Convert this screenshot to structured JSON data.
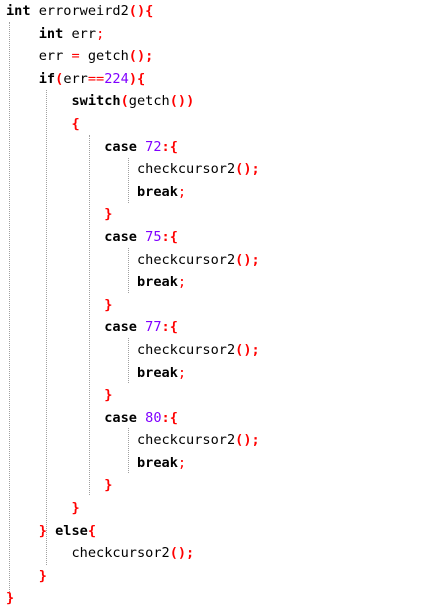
{
  "code": {
    "lines": [
      [
        {
          "t": "int",
          "c": "kw"
        },
        {
          "t": " errorweird2",
          "c": "plain"
        },
        {
          "t": "(){",
          "c": "br"
        }
      ],
      [
        {
          "t": "    ",
          "c": "plain"
        },
        {
          "t": "int",
          "c": "kw"
        },
        {
          "t": " err",
          "c": "plain"
        },
        {
          "t": ";",
          "c": "op"
        }
      ],
      [
        {
          "t": "    err ",
          "c": "plain"
        },
        {
          "t": "=",
          "c": "op"
        },
        {
          "t": " getch",
          "c": "plain"
        },
        {
          "t": "();",
          "c": "br"
        }
      ],
      [
        {
          "t": "    ",
          "c": "plain"
        },
        {
          "t": "if",
          "c": "kw"
        },
        {
          "t": "(",
          "c": "br"
        },
        {
          "t": "err",
          "c": "plain"
        },
        {
          "t": "==",
          "c": "op"
        },
        {
          "t": "224",
          "c": "num"
        },
        {
          "t": "){",
          "c": "br"
        }
      ],
      [
        {
          "t": "        ",
          "c": "plain"
        },
        {
          "t": "switch",
          "c": "kw"
        },
        {
          "t": "(",
          "c": "br"
        },
        {
          "t": "getch",
          "c": "plain"
        },
        {
          "t": "())",
          "c": "br"
        }
      ],
      [
        {
          "t": "        ",
          "c": "plain"
        },
        {
          "t": "{",
          "c": "br"
        }
      ],
      [
        {
          "t": "            ",
          "c": "plain"
        },
        {
          "t": "case",
          "c": "kw"
        },
        {
          "t": " ",
          "c": "plain"
        },
        {
          "t": "72",
          "c": "num"
        },
        {
          "t": ":{",
          "c": "br"
        }
      ],
      [
        {
          "t": "                checkcursor2",
          "c": "plain"
        },
        {
          "t": "();",
          "c": "br"
        }
      ],
      [
        {
          "t": "                ",
          "c": "plain"
        },
        {
          "t": "break",
          "c": "kw"
        },
        {
          "t": ";",
          "c": "op"
        }
      ],
      [
        {
          "t": "            ",
          "c": "plain"
        },
        {
          "t": "}",
          "c": "br"
        }
      ],
      [
        {
          "t": "            ",
          "c": "plain"
        },
        {
          "t": "case",
          "c": "kw"
        },
        {
          "t": " ",
          "c": "plain"
        },
        {
          "t": "75",
          "c": "num"
        },
        {
          "t": ":{",
          "c": "br"
        }
      ],
      [
        {
          "t": "                checkcursor2",
          "c": "plain"
        },
        {
          "t": "();",
          "c": "br"
        }
      ],
      [
        {
          "t": "                ",
          "c": "plain"
        },
        {
          "t": "break",
          "c": "kw"
        },
        {
          "t": ";",
          "c": "op"
        }
      ],
      [
        {
          "t": "            ",
          "c": "plain"
        },
        {
          "t": "}",
          "c": "br"
        }
      ],
      [
        {
          "t": "            ",
          "c": "plain"
        },
        {
          "t": "case",
          "c": "kw"
        },
        {
          "t": " ",
          "c": "plain"
        },
        {
          "t": "77",
          "c": "num"
        },
        {
          "t": ":{",
          "c": "br"
        }
      ],
      [
        {
          "t": "                checkcursor2",
          "c": "plain"
        },
        {
          "t": "();",
          "c": "br"
        }
      ],
      [
        {
          "t": "                ",
          "c": "plain"
        },
        {
          "t": "break",
          "c": "kw"
        },
        {
          "t": ";",
          "c": "op"
        }
      ],
      [
        {
          "t": "            ",
          "c": "plain"
        },
        {
          "t": "}",
          "c": "br"
        }
      ],
      [
        {
          "t": "            ",
          "c": "plain"
        },
        {
          "t": "case",
          "c": "kw"
        },
        {
          "t": " ",
          "c": "plain"
        },
        {
          "t": "80",
          "c": "num"
        },
        {
          "t": ":{",
          "c": "br"
        }
      ],
      [
        {
          "t": "                checkcursor2",
          "c": "plain"
        },
        {
          "t": "();",
          "c": "br"
        }
      ],
      [
        {
          "t": "                ",
          "c": "plain"
        },
        {
          "t": "break",
          "c": "kw"
        },
        {
          "t": ";",
          "c": "op"
        }
      ],
      [
        {
          "t": "            ",
          "c": "plain"
        },
        {
          "t": "}",
          "c": "br"
        }
      ],
      [
        {
          "t": "        ",
          "c": "plain"
        },
        {
          "t": "}",
          "c": "br"
        }
      ],
      [
        {
          "t": "    ",
          "c": "plain"
        },
        {
          "t": "}",
          "c": "br"
        },
        {
          "t": " ",
          "c": "plain"
        },
        {
          "t": "else",
          "c": "kw"
        },
        {
          "t": "{",
          "c": "br"
        }
      ],
      [
        {
          "t": "        checkcursor2",
          "c": "plain"
        },
        {
          "t": "();",
          "c": "br"
        }
      ],
      [
        {
          "t": "    ",
          "c": "plain"
        },
        {
          "t": "}",
          "c": "br"
        }
      ],
      [
        {
          "t": "}",
          "c": "br"
        }
      ]
    ]
  },
  "colors": {
    "keyword": "#000000",
    "number": "#8000ff",
    "bracket": "#ff0000",
    "text": "#000000",
    "indent_guide": "#a0a0a0",
    "background": "#ffffff"
  }
}
